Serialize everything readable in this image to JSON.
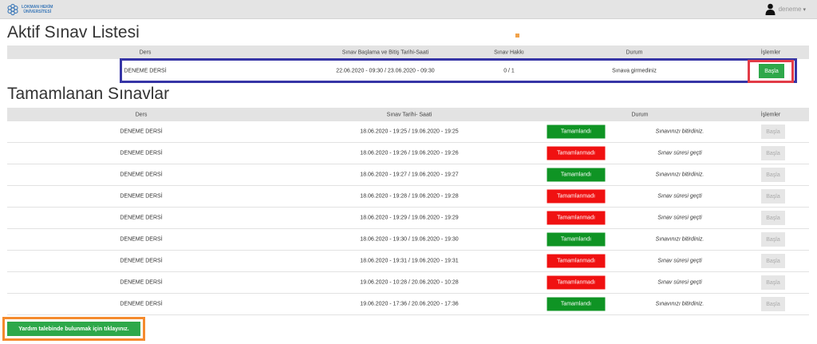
{
  "header": {
    "logo_line1": "LOKMAN HEKİM",
    "logo_line2": "ÜNİVERSİTESİ",
    "username": "deneme"
  },
  "active": {
    "title": "Aktif Sınav Listesi",
    "columns": [
      "Ders",
      "Sınav Başlama ve Bitiş Tarihi-Saati",
      "Sınav Hakkı",
      "Durum",
      "İşlemler"
    ],
    "row": {
      "course": "DENEME DERSİ",
      "dates": "22.06.2020 - 09:30 / 23.06.2020 - 09:30",
      "attempts": "0 / 1",
      "status": "Sınava girmediniz",
      "action": "Başla"
    }
  },
  "completed": {
    "title": "Tamamlanan Sınavlar",
    "columns": [
      "Ders",
      "Sınav Tarihi- Saati",
      "Durum",
      "İşlemler"
    ],
    "rows": [
      {
        "course": "DENEME DERSİ",
        "dates": "18.06.2020 - 19:25 / 19.06.2020 - 19:25",
        "status": "Tamamlandı",
        "ok": true,
        "note": "Sınavınızı bitirdiniz.",
        "action": "Başla"
      },
      {
        "course": "DENEME DERSİ",
        "dates": "18.06.2020 - 19:26 / 19.06.2020 - 19:26",
        "status": "Tamamlanmadı",
        "ok": false,
        "note": "Sınav süresi geçti",
        "action": "Başla"
      },
      {
        "course": "DENEME DERSİ",
        "dates": "18.06.2020 - 19:27 / 19.06.2020 - 19:27",
        "status": "Tamamlandı",
        "ok": true,
        "note": "Sınavınızı bitirdiniz.",
        "action": "Başla"
      },
      {
        "course": "DENEME DERSİ",
        "dates": "18.06.2020 - 19:28 / 19.06.2020 - 19:28",
        "status": "Tamamlanmadı",
        "ok": false,
        "note": "Sınav süresi geçti",
        "action": "Başla"
      },
      {
        "course": "DENEME DERSİ",
        "dates": "18.06.2020 - 19:29 / 19.06.2020 - 19:29",
        "status": "Tamamlanmadı",
        "ok": false,
        "note": "Sınav süresi geçti",
        "action": "Başla"
      },
      {
        "course": "DENEME DERSİ",
        "dates": "18.06.2020 - 19:30 / 19.06.2020 - 19:30",
        "status": "Tamamlandı",
        "ok": true,
        "note": "Sınavınızı bitirdiniz.",
        "action": "Başla"
      },
      {
        "course": "DENEME DERSİ",
        "dates": "18.06.2020 - 19:31 / 19.06.2020 - 19:31",
        "status": "Tamamlanmadı",
        "ok": false,
        "note": "Sınav süresi geçti",
        "action": "Başla"
      },
      {
        "course": "DENEME DERSİ",
        "dates": "19.06.2020 - 10:28 / 20.06.2020 - 10:28",
        "status": "Tamamlanmadı",
        "ok": false,
        "note": "Sınav süresi geçti",
        "action": "Başla"
      },
      {
        "course": "DENEME DERSİ",
        "dates": "19.06.2020 - 17:36 / 20.06.2020 - 17:36",
        "status": "Tamamlandı",
        "ok": true,
        "note": "Sınavınızı bitirdiniz.",
        "action": "Başla"
      }
    ]
  },
  "help_button": "Yardım talebinde bulunmak için tıklayınız.",
  "colors": {
    "success": "#0f9424",
    "danger": "#f01111",
    "button_green": "#2ea84a",
    "highlight_blue": "#3635a6",
    "highlight_red": "#e23b47",
    "highlight_orange": "#f58b2e"
  },
  "icons": {
    "logo": "university-logo-icon",
    "user": "user-icon",
    "dropdown": "chevron-down-icon"
  }
}
